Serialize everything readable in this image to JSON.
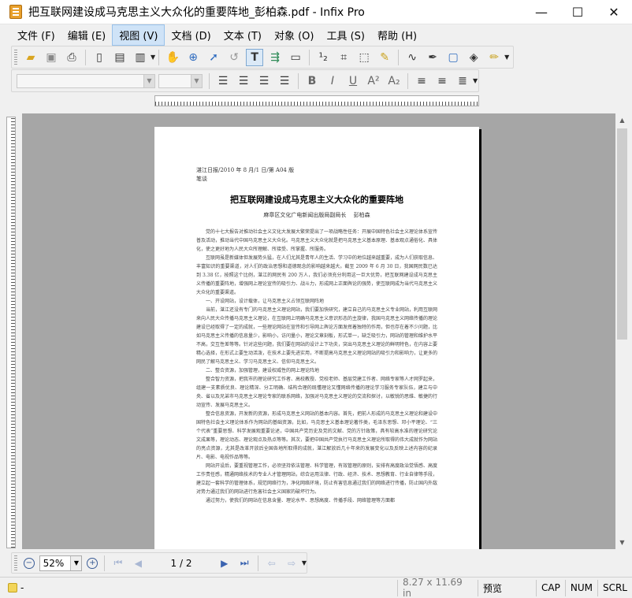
{
  "window": {
    "title": "把互联网建设成马克思主义大众化的重要阵地_彭柏森.pdf - Infix Pro",
    "minimize_glyph": "—",
    "maximize_glyph": "☐",
    "close_glyph": "✕"
  },
  "menu": [
    "文件 (F)",
    "编辑 (E)",
    "视图 (V)",
    "文档 (D)",
    "文本 (T)",
    "对象 (O)",
    "工具 (S)",
    "帮助 (H)"
  ],
  "toolbar1": {
    "icons": [
      "open-icon",
      "save-icon",
      "print-icon",
      "new-page-icon",
      "page-icon",
      "page-properties-icon",
      "hand-icon",
      "zoom-icon",
      "select-arrow-icon",
      "rotate-icon",
      "text-tool-icon",
      "text-flow-icon",
      "scanner-icon",
      "spellcheck-icon",
      "crop-icon",
      "select-box-icon",
      "highlighter-icon",
      "curve-icon",
      "eyedropper-icon",
      "rectangle-select-icon",
      "fill-icon",
      "pencil-icon"
    ]
  },
  "toolbar2": {
    "font_name": "",
    "font_size": "",
    "icons": [
      "align-left-icon",
      "align-center-icon",
      "align-right-icon",
      "justify-icon",
      "bold-icon",
      "italic-icon",
      "underline-icon",
      "superscript-icon",
      "subscript-icon",
      "line-spacing-icon",
      "paragraph-spacing-icon",
      "list-icon"
    ]
  },
  "document": {
    "header_line1": "湛江日报/2010 年 8 月/1 日/第 A04 版",
    "header_line2": "笔谈",
    "title": "把互联网建设成马克思主义大众化的重要阵地",
    "author": "麻章区文化广电新闻出版局副局长　 彭柏森",
    "paragraphs": [
      "党的十七大报告对推动社会主义文化大发展大繁荣提出了一项战略性任务：开展中国特色社会主义理论体系宣传普及活动，推动当代中国马克思主义大众化。马克思主义大众化就是把马克思主义基本原理、基本观点通俗化、具体化，使之更好地为人民大众所理解、所接受、所掌握、所服务。",
      "互联网虽是新媒体但发展势头猛，在人们尤其是青年人的生活、学习中的地位越来越重要，成为人们获取信息、丰富知识的重要渠道，对人们的政治思想和道德观念的影响越来越大。截至 2009 年 6 月 30 日，我国网民数已达到 3.38 亿，按照这个比例，湛江的网民有 200 万人，我们必须充分利用这一巨大优势，把互联网建设成马克思主义传播的重要阵地，增强网上理论宣传的吸引力、战斗力，形成网上正面舆论的强势，使互联网成为当代马克思主义大众化的重要渠道。",
      "一、开设网站，设计载体，让马克思主义占领互联网阵地",
      "当前，湛江还没有专门的马克思主义理论网站，我们要加快研究，建立自己的马克思主义专业网站，利用互联网来向人民大众传播马克思主义理论，在互联网上明确马克思主义意识形态的主旋律，我国马克思主义网络传播的理论建设已经取得了一定的成就，一些理论网站在宣传和引导网上舆论方面发挥着独特的作用，但也存在着不少问题，比如马克思主义传播的信息量少，影响小，访问量小，理论文章刻板，形式单一，缺乏吸引力，网站的管理和维护水平不高，交互性差等等。针对这些问题，我们要在网站的设计上下功夫，突出马克思主义理论的鲜明特色，在内容上要精心选择，在形式上要生动活泼，在技术上要先进实用，不断提高马克思主义理论网站的吸引力和影响力，让更多的网民了解马克思主义、学习马克思主义、信仰马克思主义。",
      "二、整合资源，加强管理，建设权威性的网上理论阵地",
      "整合智力资源，把我市的理论研究工作者、高校教授、党校老师、基层党建工作者、网络专家等人才网罗起来，组建一支素质优良、理论精深、分工明确、结构合理的既懂理论又懂网络传播的理论学习服务专家队伍，建立与中央、省以及兄弟市马克思主义理论专家的联系网络，加强对马克思主义理论的交流和探讨，以敏锐的思维、敏捷的行动宣传、发展马克思主义。",
      "整合信息资源，开发新的资源，形成马克思主义网站的基本内容。首先，把前人形成的马克思主义理论和建设中国特色社会主义理论体系作为网站的基础资源，比如，马克思主义基本理论著作类，毛泽东思想、邓小平理论、“三个代表”重要思想、科学发展观重要论述，中国共产党历史及党的文献、党的方针政策，具有较高水准的理论研究论文成果等，理论动态、理论观点及热点等等。其次，要把中国共产党执行马克思主义理论所取得的伟大成就作为网站的亮点资源，尤其是改革开放后全国各地所取得的成就，湛江解放后几十年来的发展变化以及反映上述内容的纪录片、电影、电视作品等等。",
      "网站开设后，要重视管理工作，必须坚持依法管理、科学管理，有效管理的原则，安排有高度政治觉悟感、高度工作责任感，精通网络技术的专业人才管理网站，综合运用法律、行政、经济、技术、思想教育、行业自律等手段，建立起一套科学的管理体系，规范网络行为，净化网络环境，防止有害信息通过我们的网络进行传播，防止国内外敌对势力通过我们的网站进行危害社会主义国家的破坏行为。",
      "通过努力，使我们的网站在信息含量、理论水平、思想高度、传播手段、网络管理等方面都"
    ]
  },
  "navigation": {
    "zoom_value": "52%",
    "page_indicator": "1 / 2"
  },
  "status": {
    "left_text": "-",
    "page_size": "8.27 x 11.69 in",
    "mode": "预览",
    "caps": "CAP",
    "num": "NUM",
    "scroll": "SCRL"
  }
}
